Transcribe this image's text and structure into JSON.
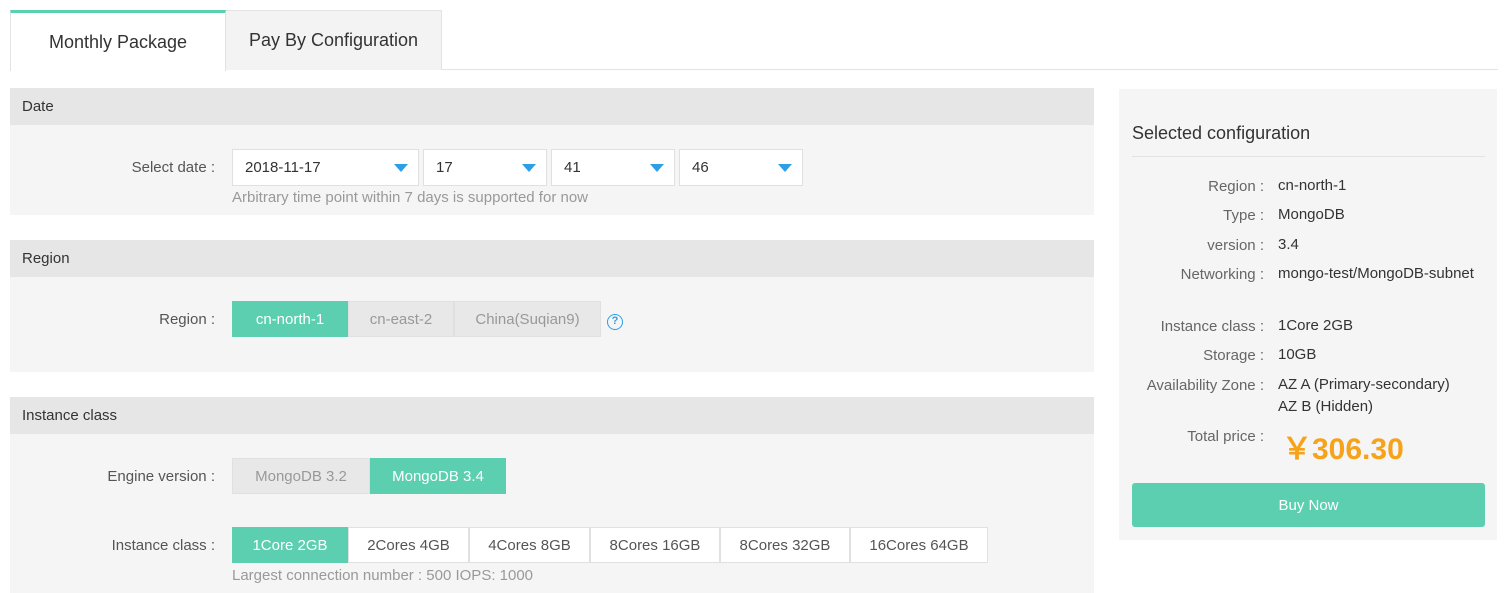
{
  "tabs": [
    {
      "label": "Monthly Package",
      "active": true
    },
    {
      "label": "Pay By Configuration",
      "active": false
    }
  ],
  "date_section": {
    "header": "Date",
    "label": "Select date :",
    "date_value": "2018-11-17",
    "hour_value": "17",
    "minute_value": "41",
    "second_value": "46",
    "hint": "Arbitrary time point within 7 days is supported for now"
  },
  "region_section": {
    "header": "Region",
    "label": "Region :",
    "options": [
      {
        "label": "cn-north-1",
        "selected": true
      },
      {
        "label": "cn-east-2",
        "selected": false
      },
      {
        "label": "China(Suqian9)",
        "selected": false
      }
    ],
    "help_icon": "question-circle-icon"
  },
  "instance_section": {
    "header": "Instance class",
    "engine_label": "Engine version :",
    "engine_options": [
      {
        "label": "MongoDB 3.2",
        "selected": false
      },
      {
        "label": "MongoDB 3.4",
        "selected": true
      }
    ],
    "class_label": "Instance class :",
    "class_options": [
      {
        "label": "1Core 2GB",
        "selected": true
      },
      {
        "label": "2Cores 4GB",
        "selected": false
      },
      {
        "label": "4Cores 8GB",
        "selected": false
      },
      {
        "label": "8Cores 16GB",
        "selected": false
      },
      {
        "label": "8Cores 32GB",
        "selected": false
      },
      {
        "label": "16Cores 64GB",
        "selected": false
      }
    ],
    "hint": "Largest connection number : 500 IOPS: 1000"
  },
  "summary": {
    "title": "Selected configuration",
    "rows": [
      {
        "label": "Region :",
        "value": "cn-north-1"
      },
      {
        "label": "Type :",
        "value": "MongoDB"
      },
      {
        "label": "version :",
        "value": "3.4"
      },
      {
        "label": "Networking :",
        "value": "mongo-test/MongoDB-subnet"
      },
      {
        "label": "Instance class :",
        "value": "1Core 2GB"
      },
      {
        "label": "Storage :",
        "value": "10GB"
      },
      {
        "label": "Availability Zone :",
        "value": "AZ A (Primary-secondary)",
        "value2": "AZ B (Hidden)"
      }
    ],
    "price_label": "Total price :",
    "price": "￥306.30",
    "buy_label": "Buy Now"
  },
  "colors": {
    "accent": "#5dcfb1",
    "price": "#f7a21b",
    "caret": "#2d9fe9",
    "panel_bg": "#f5f5f5",
    "header_bg": "#e6e6e6"
  }
}
